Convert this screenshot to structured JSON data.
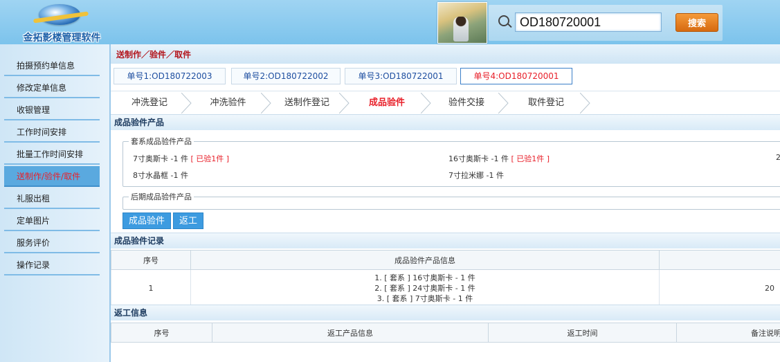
{
  "header": {
    "logo_text": "金拓影楼管理软件",
    "search": {
      "value": "OD180720001",
      "button": "搜索"
    }
  },
  "sidebar": {
    "items": [
      {
        "label": "拍摄预约单信息"
      },
      {
        "label": "修改定单信息"
      },
      {
        "label": "收银管理"
      },
      {
        "label": "工作时间安排"
      },
      {
        "label": "批量工作时间安排"
      },
      {
        "label": "送制作/验件/取件",
        "active": true
      },
      {
        "label": "礼服出租"
      },
      {
        "label": "定单图片"
      },
      {
        "label": "服务评价"
      },
      {
        "label": "操作记录"
      }
    ]
  },
  "main": {
    "breadcrumb": "送制作／验件／取件",
    "order_tabs": [
      {
        "label": "单号1:OD180722003"
      },
      {
        "label": "单号2:OD180722002"
      },
      {
        "label": "单号3:OD180722001"
      },
      {
        "label": "单号4:OD180720001",
        "active": true
      }
    ],
    "steps": [
      {
        "label": "冲洗登记"
      },
      {
        "label": "冲洗验件"
      },
      {
        "label": "送制作登记"
      },
      {
        "label": "成品验件",
        "active": true
      },
      {
        "label": "验件交接"
      },
      {
        "label": "取件登记"
      }
    ],
    "products_section": {
      "title": "成品验件产品",
      "set_group": {
        "legend": "套系成品验件产品",
        "items": [
          {
            "name": "7寸奥斯卡 -1 件",
            "status": "[ 已验1件 ]"
          },
          {
            "name": "16寸奥斯卡 -1 件",
            "status": "[ 已验1件 ]"
          },
          {
            "name": "8寸水晶框 -1 件",
            "status": ""
          },
          {
            "name": "7寸拉米娜 -1 件",
            "status": ""
          }
        ],
        "right_cut": "2"
      },
      "later_group": {
        "legend": "后期成品验件产品"
      },
      "buttons": {
        "verify": "成品验件",
        "rework": "返工"
      }
    },
    "records_section": {
      "title": "成品验件记录",
      "columns": [
        "序号",
        "成品验件产品信息",
        ""
      ],
      "rows": [
        {
          "no": "1",
          "lines": [
            "1. [ 套系 ] 16寸奥斯卡 - 1 件",
            "2. [ 套系 ] 24寸奥斯卡 - 1 件",
            "3. [ 套系 ] 7寸奥斯卡 - 1 件"
          ],
          "right_cut": "20"
        }
      ]
    },
    "rework_section": {
      "title": "返工信息",
      "columns": [
        "序号",
        "返工产品信息",
        "返工时间",
        "备注说明"
      ]
    }
  }
}
